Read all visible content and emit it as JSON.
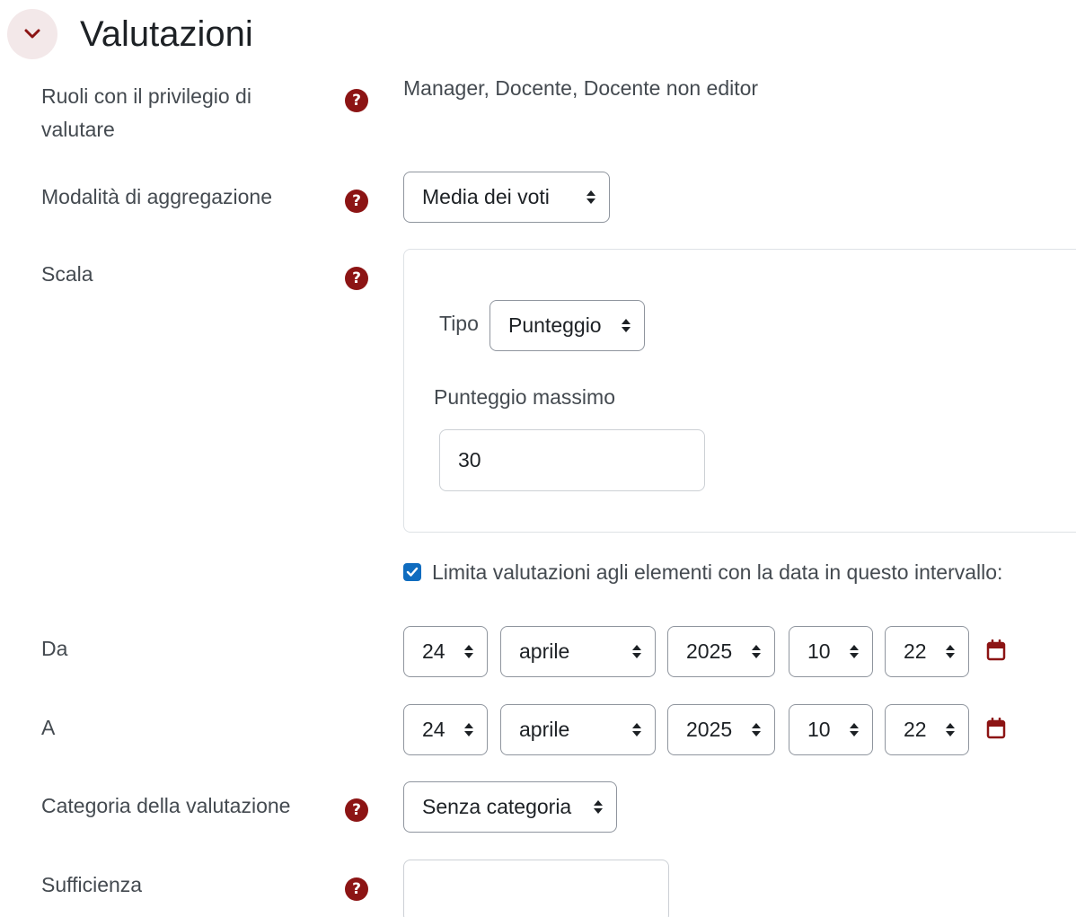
{
  "section": {
    "title": "Valutazioni",
    "collapse_icon": "chevron-down-icon"
  },
  "colors": {
    "accent": "#8c1414",
    "checkbox": "#0f6cbf",
    "label": "#444a50",
    "border": "#8f959e"
  },
  "fields": {
    "roles": {
      "label_line1": "Ruoli con il privilegio di",
      "label_line2": "valutare",
      "value": "Manager, Docente, Docente non editor",
      "help_icon": "question-circle-icon"
    },
    "aggregation": {
      "label": "Modalità di aggregazione",
      "selected": "Media dei voti"
    },
    "scale": {
      "label": "Scala",
      "type_label": "Tipo",
      "type_selected": "Punteggio",
      "max_label": "Punteggio massimo",
      "max_value": "30"
    },
    "limit": {
      "checked": true,
      "label": "Limita valutazioni agli elementi con la data in questo intervallo:"
    },
    "from": {
      "label": "Da",
      "day": "24",
      "month": "aprile",
      "year": "2025",
      "hour": "10",
      "minute": "22",
      "calendar_icon": "calendar-icon"
    },
    "to": {
      "label": "A",
      "day": "24",
      "month": "aprile",
      "year": "2025",
      "hour": "10",
      "minute": "22",
      "calendar_icon": "calendar-icon"
    },
    "category": {
      "label": "Categoria della valutazione",
      "selected": "Senza categoria"
    },
    "pass": {
      "label": "Sufficienza",
      "value": ""
    }
  }
}
